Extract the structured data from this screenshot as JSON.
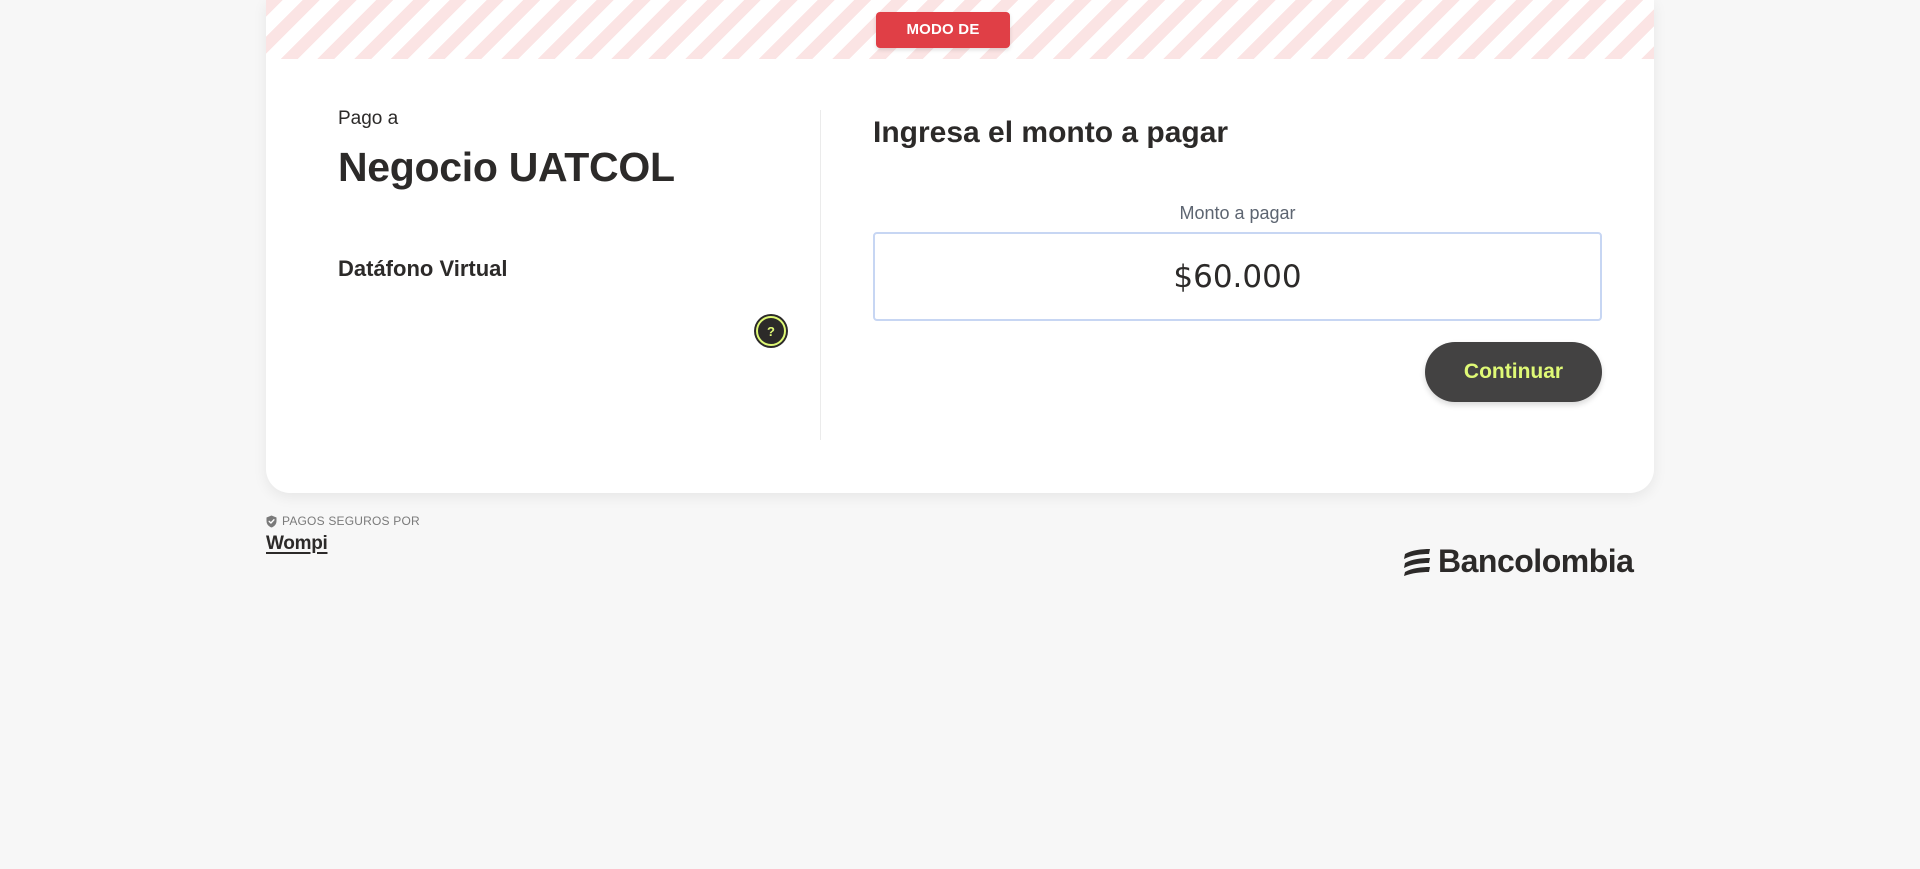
{
  "banner": {
    "badge_label": "MODO DE PRUEBAS"
  },
  "merchant_panel": {
    "pay_to_label": "Pago a",
    "merchant_name": "Negocio UATCOL",
    "product_name": "Datáfono Virtual",
    "help_icon": "question-icon",
    "help_symbol": "?"
  },
  "amount_panel": {
    "heading": "Ingresa el monto a pagar",
    "amount_label": "Monto a pagar",
    "amount_value": "$60.000",
    "continue_label": "Continuar"
  },
  "footer": {
    "secure_label": "PAGOS SEGUROS POR",
    "secure_icon": "shield-check-icon",
    "provider_name": "Wompi",
    "bank_icon": "bancolombia-logo-icon",
    "bank_name": "Bancolombia"
  },
  "colors": {
    "page_background": "#f7f7f7",
    "badge_red": "#e03f46",
    "button_dark": "#434242",
    "accent_lime": "#dff976",
    "text_dark": "#2c2a29",
    "input_border": "#c7d6f3"
  }
}
